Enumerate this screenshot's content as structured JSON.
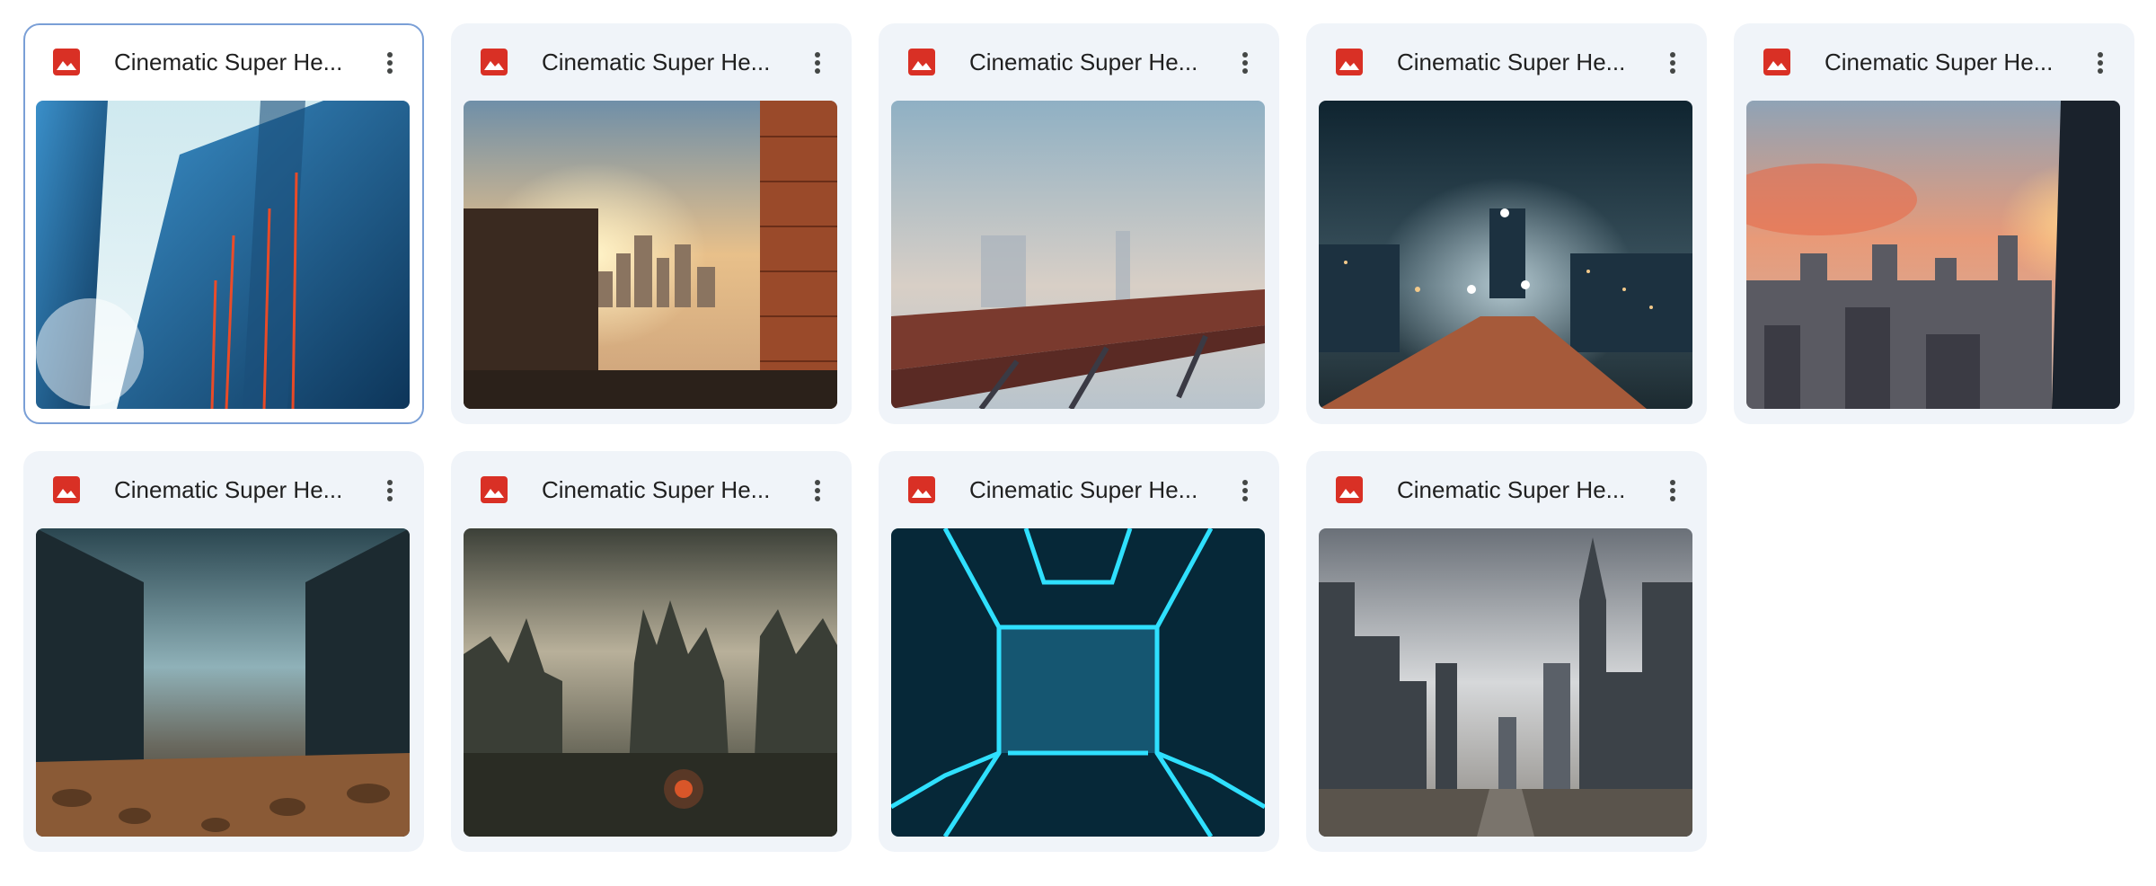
{
  "files": [
    {
      "title": "Cinematic Super He...",
      "type_icon": "image-file-icon",
      "selected": true
    },
    {
      "title": "Cinematic Super He...",
      "type_icon": "image-file-icon",
      "selected": false
    },
    {
      "title": "Cinematic Super He...",
      "type_icon": "image-file-icon",
      "selected": false
    },
    {
      "title": "Cinematic Super He...",
      "type_icon": "image-file-icon",
      "selected": false
    },
    {
      "title": "Cinematic Super He...",
      "type_icon": "image-file-icon",
      "selected": false
    },
    {
      "title": "Cinematic Super He...",
      "type_icon": "image-file-icon",
      "selected": false
    },
    {
      "title": "Cinematic Super He...",
      "type_icon": "image-file-icon",
      "selected": false
    },
    {
      "title": "Cinematic Super He...",
      "type_icon": "image-file-icon",
      "selected": false
    },
    {
      "title": "Cinematic Super He...",
      "type_icon": "image-file-icon",
      "selected": false
    }
  ],
  "colors": {
    "card_bg": "#f0f4f9",
    "selected_border": "#7a9fd6",
    "image_icon": "#d93025",
    "title_text": "#1f1f1f",
    "menu_icon": "#444746"
  },
  "more_menu_icon": "more-vert-icon"
}
